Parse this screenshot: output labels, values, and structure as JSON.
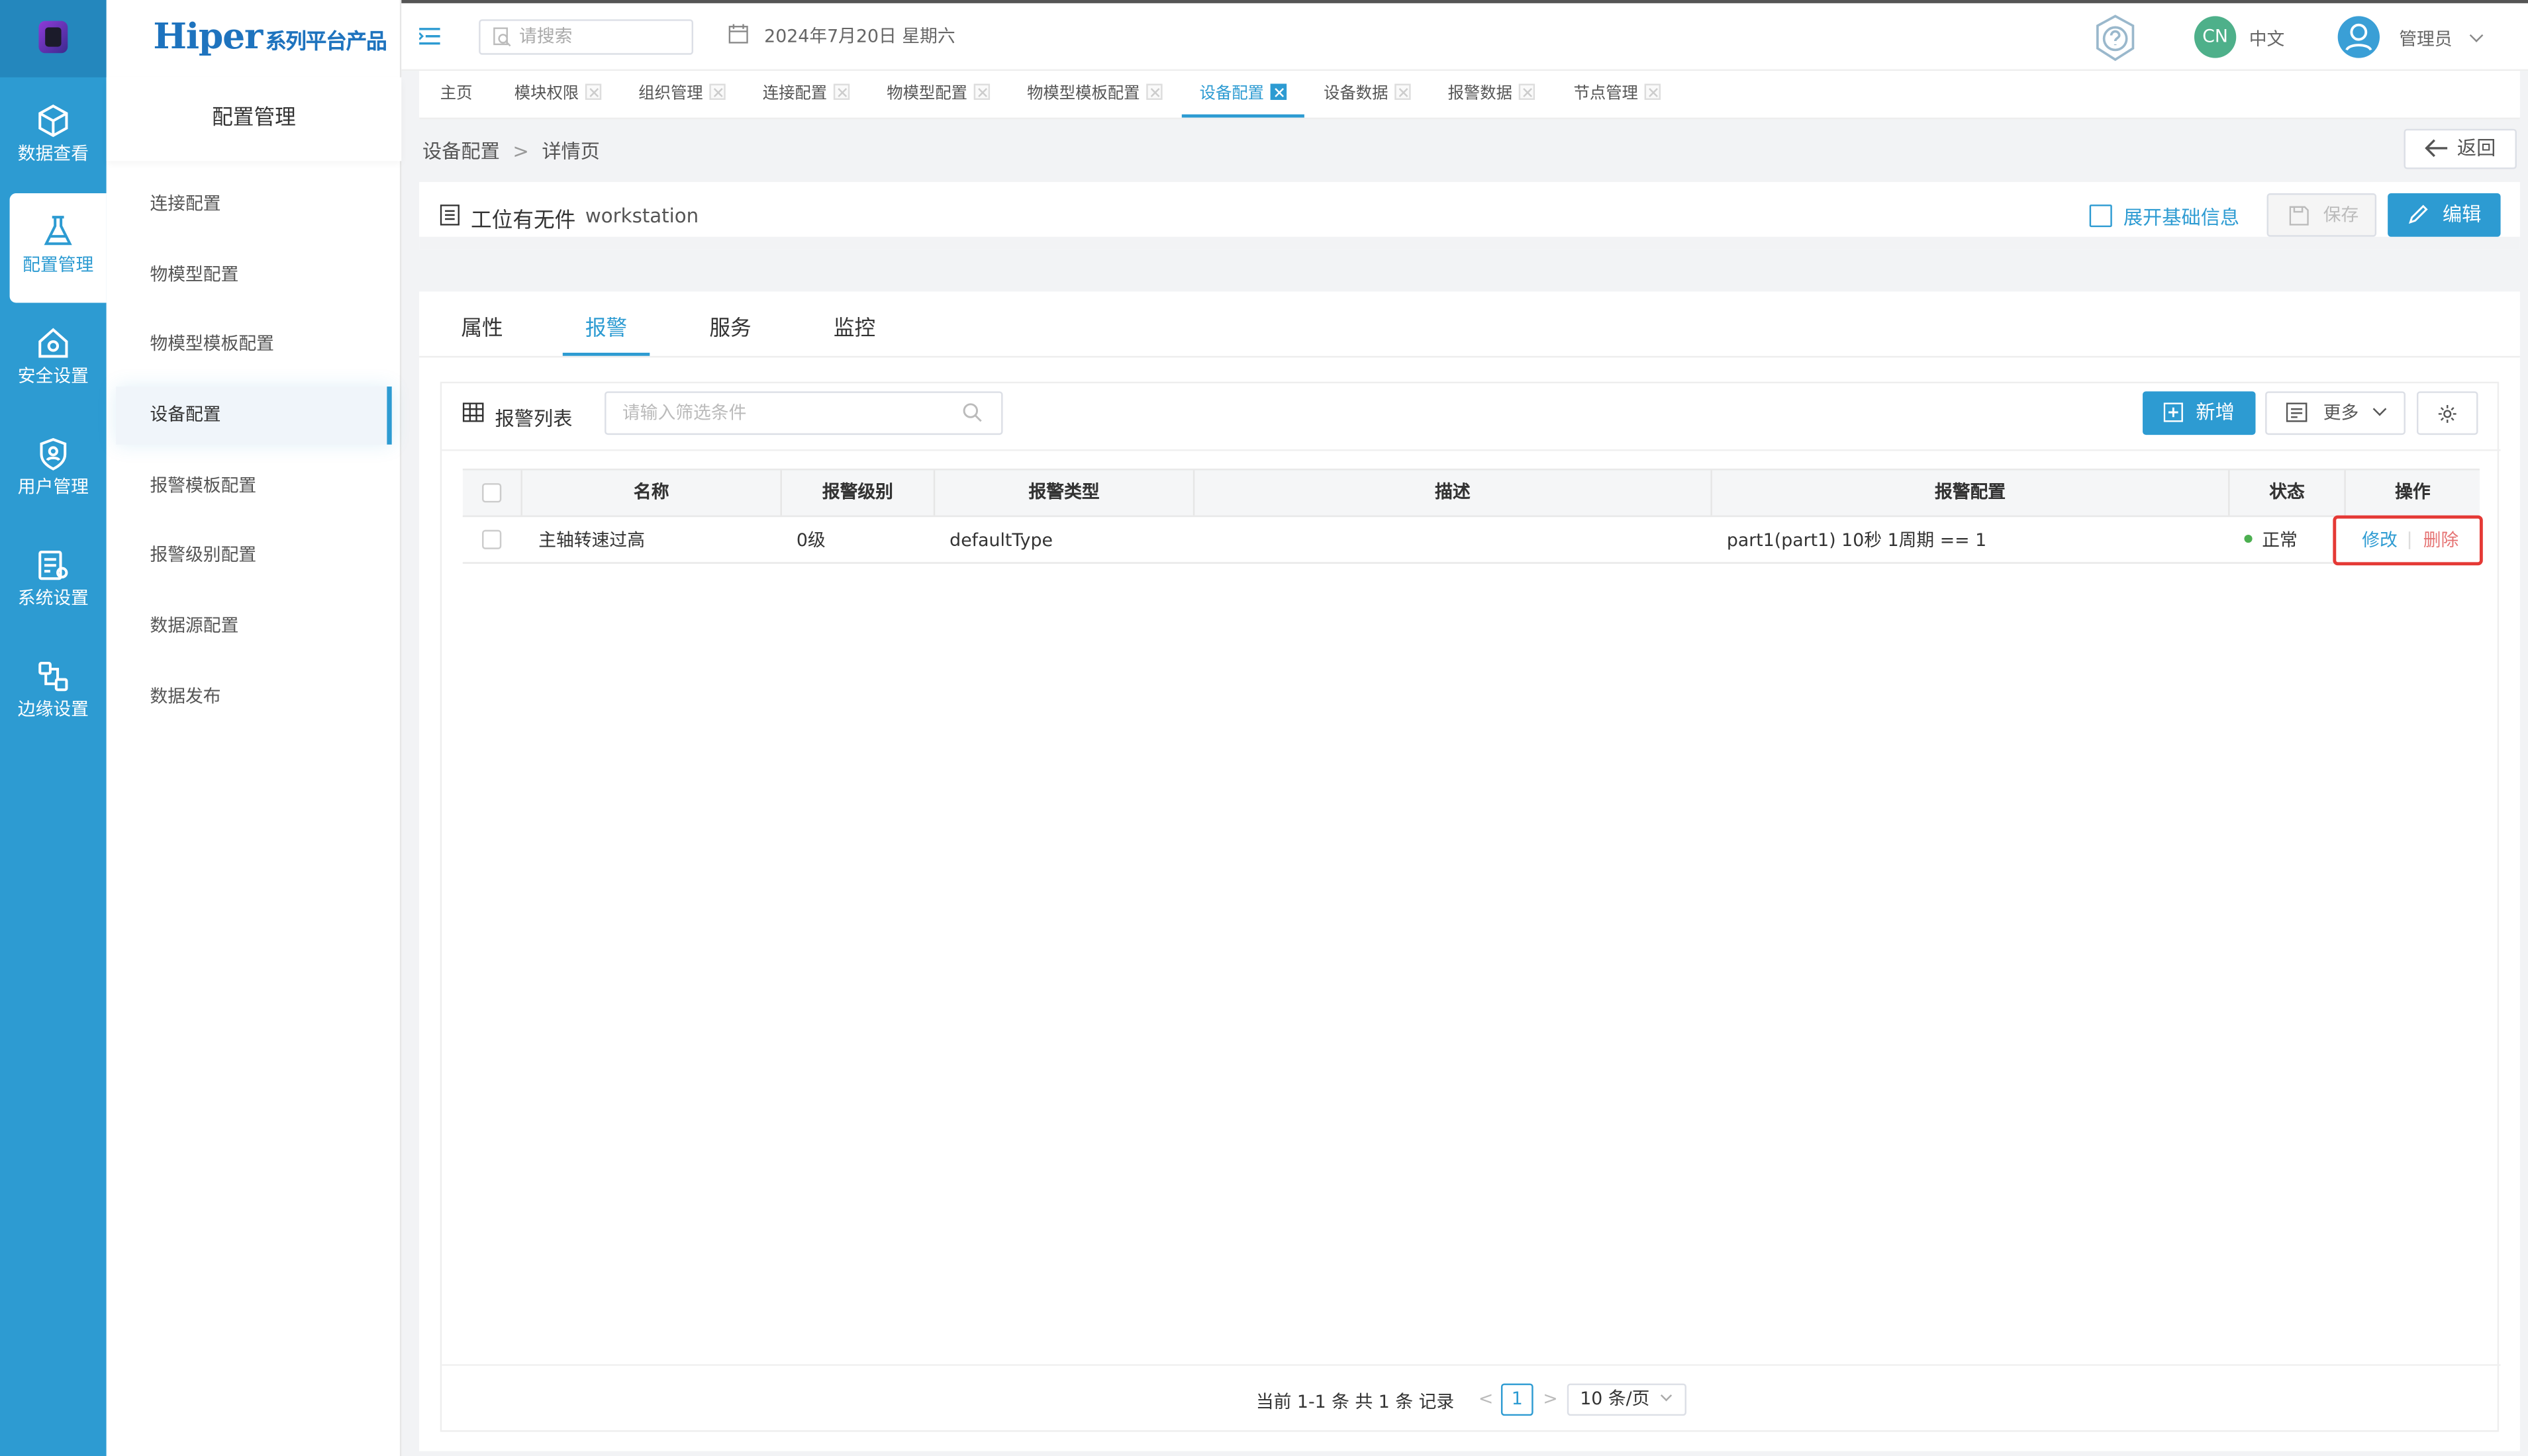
{
  "brand": {
    "name": "Hiper",
    "suffix": "系列平台产品"
  },
  "iconbar": [
    {
      "label": "数据查看",
      "icon": "cube-icon"
    },
    {
      "label": "配置管理",
      "icon": "config-flask-icon",
      "active": true
    },
    {
      "label": "安全设置",
      "icon": "security-house-icon"
    },
    {
      "label": "用户管理",
      "icon": "user-shield-icon"
    },
    {
      "label": "系统设置",
      "icon": "system-settings-icon"
    },
    {
      "label": "边缘设置",
      "icon": "edge-nodes-icon"
    }
  ],
  "sidebar": {
    "section_title": "配置管理",
    "items": [
      "连接配置",
      "物模型配置",
      "物模型模板配置",
      "设备配置",
      "报警模板配置",
      "报警级别配置",
      "数据源配置",
      "数据发布"
    ],
    "active_index": 3
  },
  "header": {
    "search_placeholder": "请搜索",
    "date": "2024年7月20日 星期六",
    "lang_badge": "CN",
    "lang": "中文",
    "user": "管理员"
  },
  "tabs": [
    {
      "label": "主页",
      "closable": false
    },
    {
      "label": "模块权限",
      "closable": true
    },
    {
      "label": "组织管理",
      "closable": true
    },
    {
      "label": "连接配置",
      "closable": true
    },
    {
      "label": "物模型配置",
      "closable": true
    },
    {
      "label": "物模型模板配置",
      "closable": true
    },
    {
      "label": "设备配置",
      "closable": true,
      "active": true
    },
    {
      "label": "设备数据",
      "closable": true
    },
    {
      "label": "报警数据",
      "closable": true
    },
    {
      "label": "节点管理",
      "closable": true
    }
  ],
  "breadcrumb": {
    "parent": "设备配置",
    "separator": ">",
    "current": "详情页"
  },
  "back_label": "返回",
  "device": {
    "title": "工位有无件",
    "name": "workstation"
  },
  "actions": {
    "expand": "展开基础信息",
    "save": "保存",
    "edit": "编辑"
  },
  "detail_tabs": [
    "属性",
    "报警",
    "服务",
    "监控"
  ],
  "alarm": {
    "list_title": "报警列表",
    "filter_placeholder": "请输入筛选条件",
    "add": "新增",
    "more": "更多",
    "columns": [
      "名称",
      "报警级别",
      "报警类型",
      "描述",
      "报警配置",
      "状态",
      "操作"
    ],
    "rows": [
      {
        "name": "主轴转速过高",
        "level": "0级",
        "type": "defaultType",
        "desc": "",
        "config": "part1(part1) 10秒 1周期 == 1",
        "status": "正常",
        "op_edit": "修改",
        "op_delete": "删除"
      }
    ]
  },
  "pagination": {
    "info": "当前 1-1 条 共 1 条 记录",
    "current": "1",
    "page_size": "10 条/页"
  },
  "colors": {
    "primary": "#2d9bd2",
    "highlight": "#e53935",
    "danger": "#e57373",
    "ok": "#4caf50"
  }
}
